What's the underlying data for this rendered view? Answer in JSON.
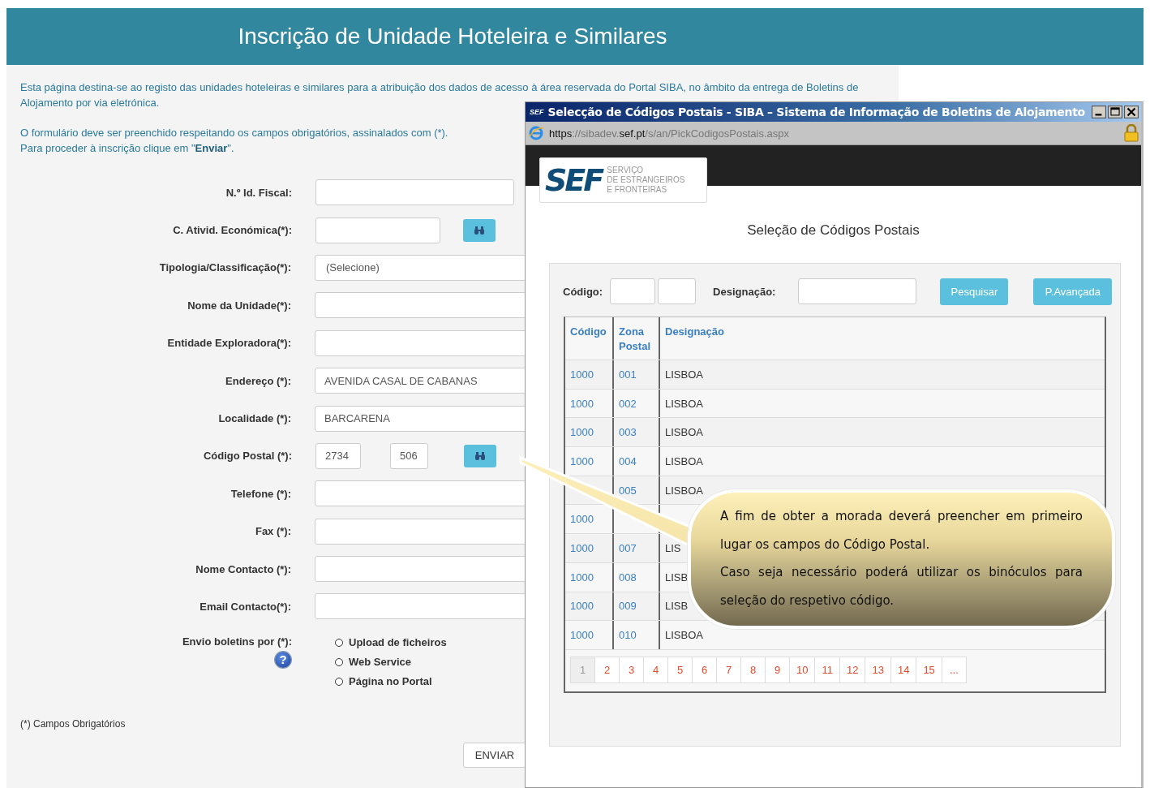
{
  "page": {
    "title": "Inscrição de Unidade Hoteleira e Similares",
    "intro": [
      "Esta página destina-se ao registo das unidades hoteleiras e similares para a atribuição dos dados de acesso à área reservada do Portal SIBA, no âmbito da entrega de Boletins de Alojamento por via eletrónica.",
      "O formulário deve ser preenchido respeitando os campos obrigatórios, assinalados com (*).",
      "Para proceder à inscrição clique em \"**Enviar**\"."
    ],
    "fields": [
      {
        "label": "N.º Id. Fiscal:",
        "kind": "number"
      },
      {
        "label": "C. Ativid. Económica(*):",
        "kind": "search"
      },
      {
        "label": "Tipologia/Classificação(*):",
        "kind": "select",
        "value": "(Selecione)"
      },
      {
        "label": "Nome da Unidade(*):",
        "kind": "text"
      },
      {
        "label": "Entidade Exploradora(*):",
        "kind": "text"
      },
      {
        "label": "Endereço (*):",
        "kind": "text",
        "value": "AVENIDA CASAL DE CABANAS"
      },
      {
        "label": "Localidade (*):",
        "kind": "text",
        "value": "BARCARENA"
      },
      {
        "label": "Código Postal (*):",
        "kind": "postal",
        "values": [
          "2734",
          "506"
        ]
      },
      {
        "label": "Telefone (*):",
        "kind": "text"
      },
      {
        "label": "Fax (*):",
        "kind": "text"
      },
      {
        "label": "Nome Contacto (*):",
        "kind": "text"
      },
      {
        "label": "Email Contacto(*):",
        "kind": "text"
      }
    ],
    "delivery": {
      "label": "Envio boletins por (*):",
      "help_icon": "?",
      "options": [
        {
          "label": "Upload de ficheiros",
          "selected": false
        },
        {
          "label": "Web Service",
          "selected": false
        },
        {
          "label": "Página no Portal",
          "selected": false
        }
      ]
    },
    "footnote": "(*) Campos Obrigatórios",
    "submit": "ENVIAR"
  },
  "popup": {
    "title": "Selecção de Códigos Postais - SIBA – Sistema de Informação de Boletins de Alojamento",
    "icon_text": "SEF",
    "url": [
      {
        "text": "https",
        "strong": true
      },
      {
        "text": "://sibadev.",
        "strong": false
      },
      {
        "text": "sef.pt",
        "strong": true
      },
      {
        "text": "/s/an/PickCodigosPostais.aspx",
        "strong": false
      }
    ],
    "logo": {
      "mark": "SEF",
      "lines": [
        "SERVIÇO",
        "DE ESTRANGEIROS",
        "E FRONTEIRAS"
      ]
    },
    "heading": "Seleção de Códigos Postais",
    "search": {
      "code_label": "Código:",
      "name_label": "Designação:",
      "buttons": [
        "Pesquisar",
        "P.Avançada"
      ]
    },
    "table": {
      "columns": [
        "Código",
        "Zona Postal",
        "Designação"
      ],
      "rows": [
        [
          "1000",
          "001",
          "LISBOA"
        ],
        [
          "1000",
          "002",
          "LISBOA"
        ],
        [
          "1000",
          "003",
          "LISBOA"
        ],
        [
          "1000",
          "004",
          "LISBOA"
        ],
        [
          "",
          "005",
          "LISBOA"
        ],
        [
          "1000",
          "",
          ""
        ],
        [
          "1000",
          "007",
          "LIS"
        ],
        [
          "1000",
          "008",
          "LISB"
        ],
        [
          "1000",
          "009",
          "LISB"
        ],
        [
          "1000",
          "010",
          "LISBOA"
        ]
      ]
    },
    "pages": [
      {
        "label": "1",
        "selected": true
      },
      {
        "label": "2",
        "selected": false
      },
      {
        "label": "3",
        "selected": false
      },
      {
        "label": "4",
        "selected": false
      },
      {
        "label": "5",
        "selected": false
      },
      {
        "label": "6",
        "selected": false
      },
      {
        "label": "7",
        "selected": false
      },
      {
        "label": "8",
        "selected": false
      },
      {
        "label": "9",
        "selected": false
      },
      {
        "label": "10",
        "selected": false
      },
      {
        "label": "11",
        "selected": false
      },
      {
        "label": "12",
        "selected": false
      },
      {
        "label": "13",
        "selected": false
      },
      {
        "label": "14",
        "selected": false
      },
      {
        "label": "15",
        "selected": false
      },
      {
        "label": "...",
        "selected": false
      }
    ]
  },
  "callout": [
    "A fim de obter a morada deverá preencher em primeiro lugar os campos do Código Postal.",
    "Caso seja necessário poderá utilizar os binóculos para seleção do respetivo código."
  ]
}
